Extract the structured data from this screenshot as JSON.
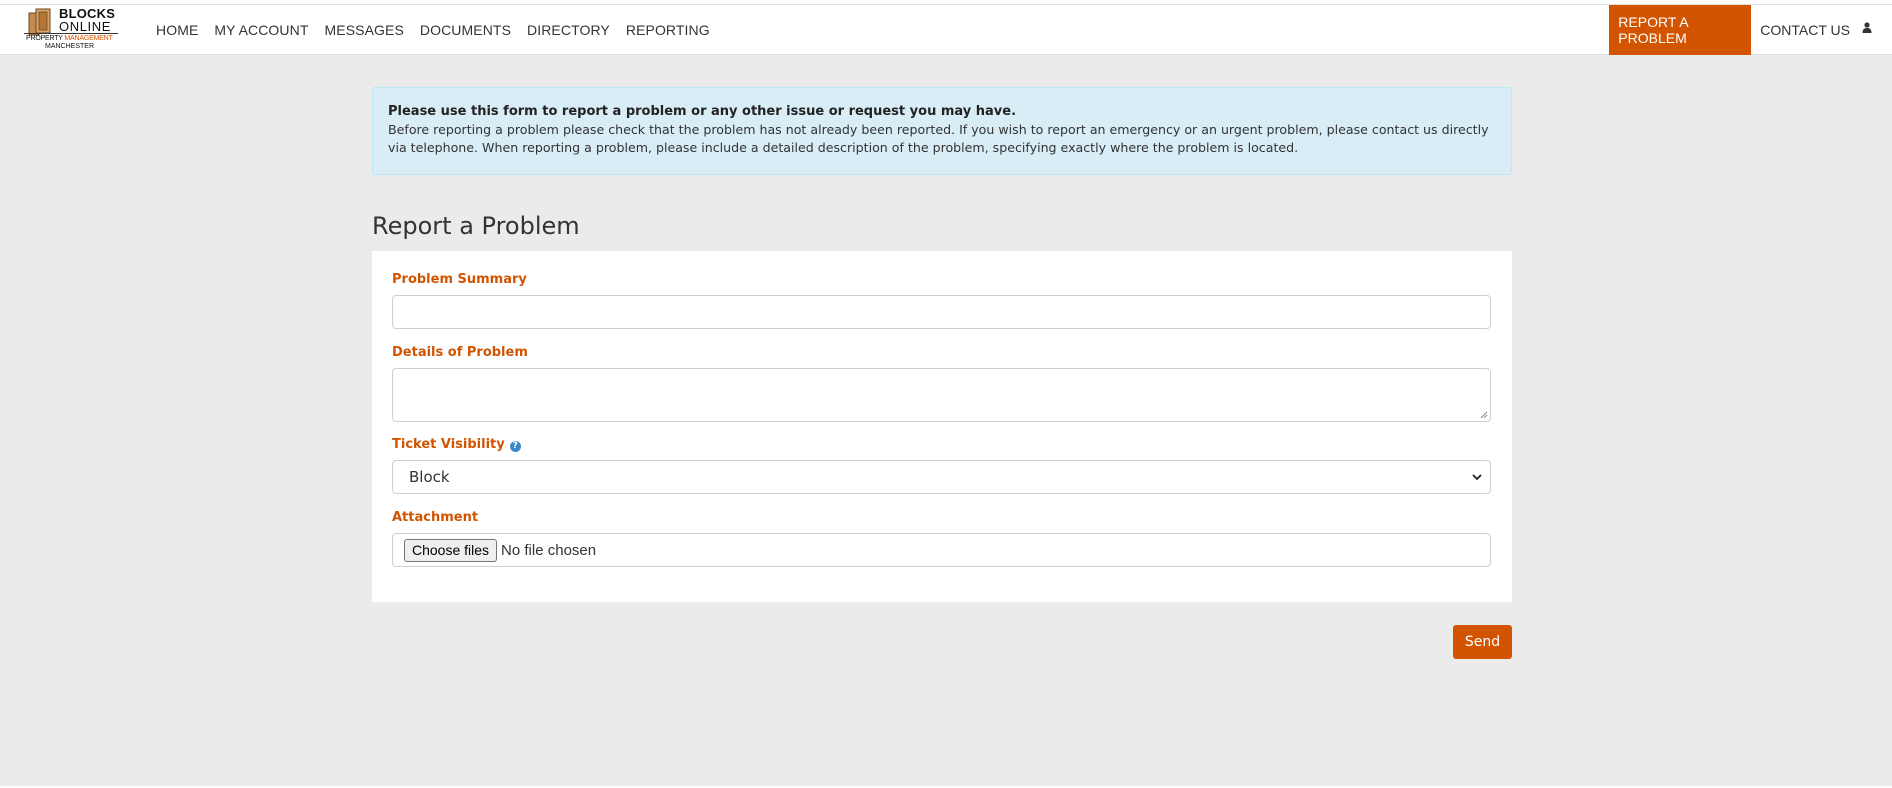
{
  "brand": {
    "name_line1": "BLOCKS",
    "name_line2": "ONLINE",
    "tagline_part1": "PROPERTY ",
    "tagline_part2": "MANAGEMENT",
    "tagline_city": "MANCHESTER",
    "accent_color": "#d35400"
  },
  "nav": {
    "items": [
      {
        "label": "HOME"
      },
      {
        "label": "MY ACCOUNT"
      },
      {
        "label": "MESSAGES"
      },
      {
        "label": "DOCUMENTS"
      },
      {
        "label": "DIRECTORY"
      },
      {
        "label": "REPORTING"
      }
    ],
    "report_problem": "REPORT A PROBLEM",
    "contact_us": "CONTACT US",
    "user_icon": "user-icon"
  },
  "info": {
    "lead": "Please use this form to report a problem or any other issue or request you may have.",
    "body": "Before reporting a problem please check that the problem has not already been reported. If you wish to report an emergency or an urgent problem, please contact us directly via telephone. When reporting a problem, please include a detailed description of the problem, specifying exactly where the problem is located."
  },
  "form": {
    "title": "Report a Problem",
    "summary_label": "Problem Summary",
    "summary_value": "",
    "details_label": "Details of Problem",
    "details_value": "",
    "visibility_label": "Ticket Visibility",
    "visibility_help_icon": "question-circle-icon",
    "visibility_value": "Block",
    "attachment_label": "Attachment",
    "choose_files": "Choose files",
    "no_file": "No file chosen",
    "send": "Send"
  }
}
